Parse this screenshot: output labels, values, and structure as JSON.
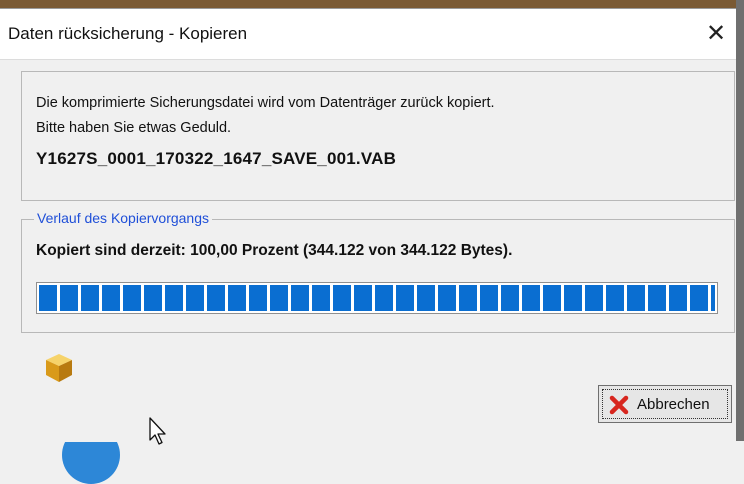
{
  "window": {
    "title": "Daten rücksicherung - Kopieren",
    "close_glyph": "✕"
  },
  "info": {
    "line1": "Die komprimierte Sicherungsdatei wird vom Datenträger zurück kopiert.",
    "line2": "Bitte haben Sie etwas Geduld.",
    "filename": "Y1627S_0001_170322_1647_SAVE_001.VAB"
  },
  "progress_group": {
    "legend": "Verlauf des Kopiervorgangs",
    "status": "Kopiert sind derzeit: 100,00 Prozent (344.122 von 344.122 Bytes).",
    "progress_percent": 100
  },
  "buttons": {
    "cancel_label": "Abbrechen"
  },
  "colors": {
    "progress_blue": "#0a6ed1",
    "legend_blue": "#1f4fd8",
    "cancel_red": "#d7261e"
  },
  "icons": {
    "cube": "package-cube-icon",
    "cancel": "red-x-icon",
    "cursor": "mouse-pointer-icon"
  }
}
